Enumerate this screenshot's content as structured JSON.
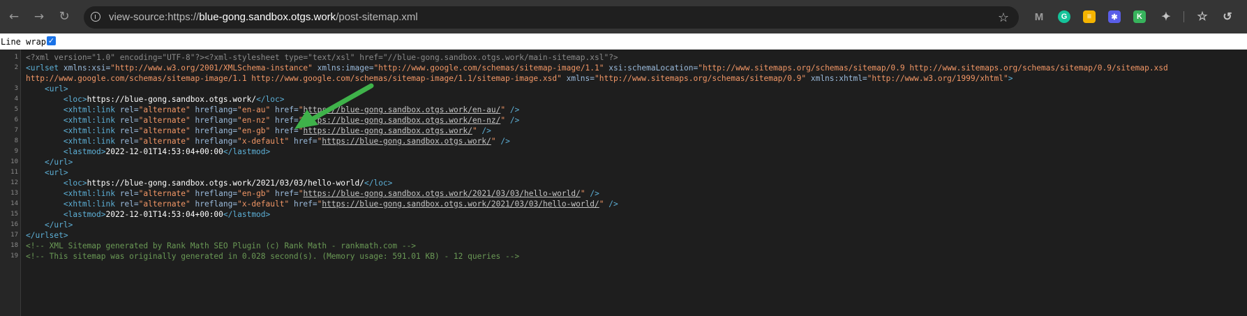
{
  "browser": {
    "url_scheme": "view-source:https://",
    "url_host": "blue-gong.sandbox.otgs.work",
    "url_path": "/post-sitemap.xml",
    "nav": {
      "back": "back-arrow-icon",
      "forward": "forward-arrow-icon",
      "reload": "reload-icon"
    },
    "extensions": [
      {
        "name": "malwarebytes-icon",
        "color": "#9c9c9c",
        "glyph": "M"
      },
      {
        "name": "grammarly-icon",
        "color": "#15c39a",
        "glyph": "G"
      },
      {
        "name": "notes-extension-icon",
        "color": "#f5b400",
        "glyph": "≡"
      },
      {
        "name": "gear-extension-icon",
        "color": "#5a5ee8",
        "glyph": "✱"
      },
      {
        "name": "k-extension-icon",
        "color": "#37b35c",
        "glyph": "K"
      }
    ]
  },
  "viewer": {
    "line_wrap_label": "Line wrap",
    "line_wrap_checked": "✓"
  },
  "lines": [
    {
      "n": "1",
      "segments": [
        {
          "c": "pi",
          "t": "<?xml version=\"1.0\" encoding=\"UTF-8\"?><?xml-stylesheet type=\"text/xsl\" href=\"//blue-gong.sandbox.otgs.work/main-sitemap.xsl\"?>"
        }
      ]
    },
    {
      "n": "2",
      "segments": [
        {
          "c": "tag",
          "t": "<urlset "
        },
        {
          "c": "attr",
          "t": "xmlns:xsi="
        },
        {
          "c": "val",
          "t": "\"http://www.w3.org/2001/XMLSchema-instance\" "
        },
        {
          "c": "attr",
          "t": "xmlns:image="
        },
        {
          "c": "val",
          "t": "\"http://www.google.com/schemas/sitemap-image/1.1\" "
        },
        {
          "c": "attr",
          "t": "xsi:schemaLocation="
        },
        {
          "c": "val",
          "t": "\"http://www.sitemaps.org/schemas/sitemap/0.9 http://www.sitemaps.org/schemas/sitemap/0.9/sitemap.xsd"
        }
      ]
    },
    {
      "n": "",
      "segments": [
        {
          "c": "val",
          "t": "http://www.google.com/schemas/sitemap-image/1.1 http://www.google.com/schemas/sitemap-image/1.1/sitemap-image.xsd\" "
        },
        {
          "c": "attr",
          "t": "xmlns="
        },
        {
          "c": "val",
          "t": "\"http://www.sitemaps.org/schemas/sitemap/0.9\" "
        },
        {
          "c": "attr",
          "t": "xmlns:xhtml="
        },
        {
          "c": "val",
          "t": "\"http://www.w3.org/1999/xhtml\""
        },
        {
          "c": "tag",
          "t": ">"
        }
      ]
    },
    {
      "n": "3",
      "segments": [
        {
          "c": "txt",
          "t": "    "
        },
        {
          "c": "tag",
          "t": "<url>"
        }
      ]
    },
    {
      "n": "4",
      "segments": [
        {
          "c": "txt",
          "t": "        "
        },
        {
          "c": "tag",
          "t": "<loc>"
        },
        {
          "c": "txt",
          "t": "https://blue-gong.sandbox.otgs.work/"
        },
        {
          "c": "tag",
          "t": "</loc>"
        }
      ]
    },
    {
      "n": "5",
      "segments": [
        {
          "c": "txt",
          "t": "        "
        },
        {
          "c": "tag",
          "t": "<xhtml:link "
        },
        {
          "c": "attr",
          "t": "rel="
        },
        {
          "c": "val",
          "t": "\"alternate\" "
        },
        {
          "c": "attr",
          "t": "hreflang="
        },
        {
          "c": "val",
          "t": "\"en-au\" "
        },
        {
          "c": "attr",
          "t": "href="
        },
        {
          "c": "val",
          "t": "\""
        },
        {
          "c": "link",
          "t": "https://blue-gong.sandbox.otgs.work/en-au/"
        },
        {
          "c": "val",
          "t": "\""
        },
        {
          "c": "tag",
          "t": " />"
        }
      ]
    },
    {
      "n": "6",
      "segments": [
        {
          "c": "txt",
          "t": "        "
        },
        {
          "c": "tag",
          "t": "<xhtml:link "
        },
        {
          "c": "attr",
          "t": "rel="
        },
        {
          "c": "val",
          "t": "\"alternate\" "
        },
        {
          "c": "attr",
          "t": "hreflang="
        },
        {
          "c": "val",
          "t": "\"en-nz\" "
        },
        {
          "c": "attr",
          "t": "href="
        },
        {
          "c": "val",
          "t": "\""
        },
        {
          "c": "link",
          "t": "https://blue-gong.sandbox.otgs.work/en-nz/"
        },
        {
          "c": "val",
          "t": "\""
        },
        {
          "c": "tag",
          "t": " />"
        }
      ]
    },
    {
      "n": "7",
      "segments": [
        {
          "c": "txt",
          "t": "        "
        },
        {
          "c": "tag",
          "t": "<xhtml:link "
        },
        {
          "c": "attr",
          "t": "rel="
        },
        {
          "c": "val",
          "t": "\"alternate\" "
        },
        {
          "c": "attr",
          "t": "hreflang="
        },
        {
          "c": "val",
          "t": "\"en-gb\" "
        },
        {
          "c": "attr",
          "t": "href="
        },
        {
          "c": "val",
          "t": "\""
        },
        {
          "c": "link",
          "t": "https://blue-gong.sandbox.otgs.work/"
        },
        {
          "c": "val",
          "t": "\""
        },
        {
          "c": "tag",
          "t": " />"
        }
      ]
    },
    {
      "n": "8",
      "segments": [
        {
          "c": "txt",
          "t": "        "
        },
        {
          "c": "tag",
          "t": "<xhtml:link "
        },
        {
          "c": "attr",
          "t": "rel="
        },
        {
          "c": "val",
          "t": "\"alternate\" "
        },
        {
          "c": "attr",
          "t": "hreflang="
        },
        {
          "c": "val",
          "t": "\"x-default\" "
        },
        {
          "c": "attr",
          "t": "href="
        },
        {
          "c": "val",
          "t": "\""
        },
        {
          "c": "link",
          "t": "https://blue-gong.sandbox.otgs.work/"
        },
        {
          "c": "val",
          "t": "\""
        },
        {
          "c": "tag",
          "t": " />"
        }
      ]
    },
    {
      "n": "9",
      "segments": [
        {
          "c": "txt",
          "t": "        "
        },
        {
          "c": "tag",
          "t": "<lastmod>"
        },
        {
          "c": "txt",
          "t": "2022-12-01T14:53:04+00:00"
        },
        {
          "c": "tag",
          "t": "</lastmod>"
        }
      ]
    },
    {
      "n": "10",
      "segments": [
        {
          "c": "txt",
          "t": "    "
        },
        {
          "c": "tag",
          "t": "</url>"
        }
      ]
    },
    {
      "n": "11",
      "segments": [
        {
          "c": "txt",
          "t": "    "
        },
        {
          "c": "tag",
          "t": "<url>"
        }
      ]
    },
    {
      "n": "12",
      "segments": [
        {
          "c": "txt",
          "t": "        "
        },
        {
          "c": "tag",
          "t": "<loc>"
        },
        {
          "c": "txt",
          "t": "https://blue-gong.sandbox.otgs.work/2021/03/03/hello-world/"
        },
        {
          "c": "tag",
          "t": "</loc>"
        }
      ]
    },
    {
      "n": "13",
      "segments": [
        {
          "c": "txt",
          "t": "        "
        },
        {
          "c": "tag",
          "t": "<xhtml:link "
        },
        {
          "c": "attr",
          "t": "rel="
        },
        {
          "c": "val",
          "t": "\"alternate\" "
        },
        {
          "c": "attr",
          "t": "hreflang="
        },
        {
          "c": "val",
          "t": "\"en-gb\" "
        },
        {
          "c": "attr",
          "t": "href="
        },
        {
          "c": "val",
          "t": "\""
        },
        {
          "c": "link",
          "t": "https://blue-gong.sandbox.otgs.work/2021/03/03/hello-world/"
        },
        {
          "c": "val",
          "t": "\""
        },
        {
          "c": "tag",
          "t": " />"
        }
      ]
    },
    {
      "n": "14",
      "segments": [
        {
          "c": "txt",
          "t": "        "
        },
        {
          "c": "tag",
          "t": "<xhtml:link "
        },
        {
          "c": "attr",
          "t": "rel="
        },
        {
          "c": "val",
          "t": "\"alternate\" "
        },
        {
          "c": "attr",
          "t": "hreflang="
        },
        {
          "c": "val",
          "t": "\"x-default\" "
        },
        {
          "c": "attr",
          "t": "href="
        },
        {
          "c": "val",
          "t": "\""
        },
        {
          "c": "link",
          "t": "https://blue-gong.sandbox.otgs.work/2021/03/03/hello-world/"
        },
        {
          "c": "val",
          "t": "\""
        },
        {
          "c": "tag",
          "t": " />"
        }
      ]
    },
    {
      "n": "15",
      "segments": [
        {
          "c": "txt",
          "t": "        "
        },
        {
          "c": "tag",
          "t": "<lastmod>"
        },
        {
          "c": "txt",
          "t": "2022-12-01T14:53:04+00:00"
        },
        {
          "c": "tag",
          "t": "</lastmod>"
        }
      ]
    },
    {
      "n": "16",
      "segments": [
        {
          "c": "txt",
          "t": "    "
        },
        {
          "c": "tag",
          "t": "</url>"
        }
      ]
    },
    {
      "n": "17",
      "segments": [
        {
          "c": "tag",
          "t": "</urlset>"
        }
      ]
    },
    {
      "n": "18",
      "segments": [
        {
          "c": "comment",
          "t": "<!-- XML Sitemap generated by Rank Math SEO Plugin (c) Rank Math - rankmath.com -->"
        }
      ]
    },
    {
      "n": "19",
      "segments": [
        {
          "c": "comment",
          "t": "<!-- This sitemap was originally generated in 0.028 second(s). (Memory usage: 591.01 KB) - 12 queries -->"
        }
      ]
    }
  ]
}
